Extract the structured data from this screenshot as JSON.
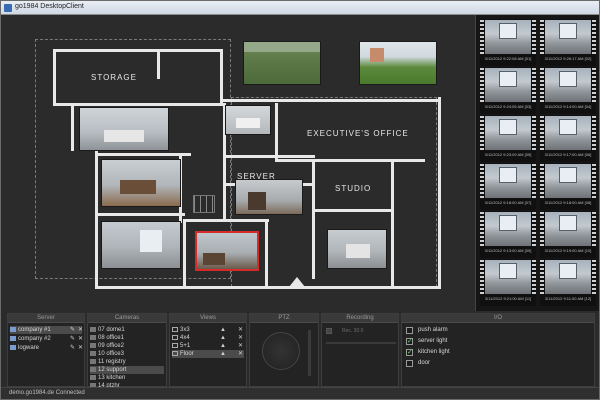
{
  "window": {
    "title": "go1984 DesktopClient"
  },
  "plan": {
    "labels": {
      "storage": "STORAGE",
      "executive": "EXECUTIVE'S OFFICE",
      "server": "SERVER",
      "studio": "STUDIO"
    }
  },
  "thumbnails": [
    "3/11/2012 9:22:08 AM [01]",
    "3/11/2012 9:26:17 AM [02]",
    "3/11/2012 9:24:05 AM [03]",
    "3/11/2012 9:14:00 AM [04]",
    "3/11/2012 9:23:09 AM [05]",
    "3/11/2012 9:17:00 AM [06]",
    "3/11/2012 9:18:00 AM [07]",
    "3/11/2012 9:18:00 AM [08]",
    "3/11/2012 9:13:00 AM [09]",
    "3/11/2012 9:19:00 AM [10]",
    "3/11/2012 9:21:00 AM [11]",
    "3/11/2012 9:11:00 AM [12]"
  ],
  "panels": {
    "server": {
      "header": "Server",
      "items": [
        {
          "label": "company #1",
          "selected": true
        },
        {
          "label": "company #2",
          "selected": false
        },
        {
          "label": "logware",
          "selected": false
        }
      ]
    },
    "cameras": {
      "header": "Cameras",
      "items": [
        {
          "label": "07 dome1",
          "selected": false
        },
        {
          "label": "08 office1",
          "selected": false
        },
        {
          "label": "09 office2",
          "selected": false
        },
        {
          "label": "10 office3",
          "selected": false
        },
        {
          "label": "11 registry",
          "selected": false
        },
        {
          "label": "12 support",
          "selected": true
        },
        {
          "label": "13 kitchen",
          "selected": false
        },
        {
          "label": "14 ptzhr",
          "selected": false
        }
      ]
    },
    "views": {
      "header": "Views",
      "items": [
        {
          "label": "3x3",
          "selected": false
        },
        {
          "label": "4x4",
          "selected": false
        },
        {
          "label": "5+1",
          "selected": false
        },
        {
          "label": "Floor",
          "selected": true
        }
      ]
    },
    "ptz": {
      "header": "PTZ"
    },
    "recording": {
      "header": "Recording",
      "field": "Rec. 30.0"
    },
    "io": {
      "header": "I/O",
      "items": [
        {
          "label": "push alarm",
          "checked": false
        },
        {
          "label": "server light",
          "checked": true
        },
        {
          "label": "kitchen light",
          "checked": true
        },
        {
          "label": "door",
          "checked": false
        }
      ]
    }
  },
  "status": {
    "text": "demo.go1984.de Connected"
  }
}
